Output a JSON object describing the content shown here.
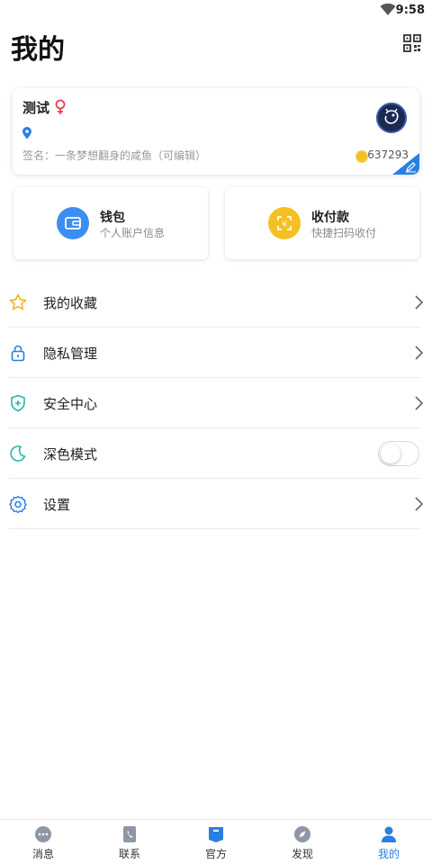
{
  "status_bar": {
    "time": "9:58"
  },
  "header": {
    "title": "我的",
    "qr_icon": "qr-code-icon"
  },
  "profile": {
    "name": "测试",
    "gender_icon": "female-icon",
    "location_icon": "location-pin-icon",
    "signature": "签名：一条梦想翻身的咸鱼（可编辑）",
    "coins": "637293"
  },
  "actions": [
    {
      "title": "钱包",
      "subtitle": "个人账户信息",
      "icon": "wallet-icon",
      "color": "#3b8ff0"
    },
    {
      "title": "收付款",
      "subtitle": "快捷扫码收付",
      "icon": "scan-pay-icon",
      "color": "#f5c021"
    }
  ],
  "menu": [
    {
      "label": "我的收藏",
      "icon": "star-icon"
    },
    {
      "label": "隐私管理",
      "icon": "lock-icon"
    },
    {
      "label": "安全中心",
      "icon": "shield-icon"
    },
    {
      "label": "深色模式",
      "icon": "moon-icon",
      "toggle": false
    },
    {
      "label": "设置",
      "icon": "gear-icon"
    }
  ],
  "tabs": [
    {
      "label": "消息",
      "icon": "message-icon"
    },
    {
      "label": "联系",
      "icon": "contacts-icon"
    },
    {
      "label": "官方",
      "icon": "official-icon"
    },
    {
      "label": "发现",
      "icon": "compass-icon"
    },
    {
      "label": "我的",
      "icon": "profile-icon",
      "active": true
    }
  ],
  "colors": {
    "accent": "#2a7fe4",
    "inactive_icon": "#8f97a6",
    "female": "#e8424c",
    "coin": "#f5c021"
  }
}
